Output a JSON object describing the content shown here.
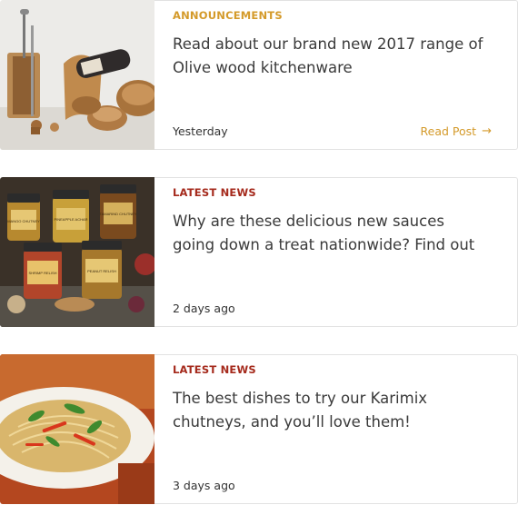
{
  "posts": [
    {
      "category": "ANNOUNCEMENTS",
      "title": "Read about our brand new 2017 range of Olive wood kitchenware",
      "date": "Yesterday",
      "link_label": "Read Post",
      "link_icon": "arrow-right-icon",
      "category_color": "#d49a2a",
      "image": "olive-wood-kitchenware-photo"
    },
    {
      "category": "LATEST NEWS",
      "title": "Why are these delicious new sauces going down a treat nationwide? Find out",
      "date": "2 days ago",
      "category_color": "#a52a1c",
      "image": "karimix-sauce-jars-photo",
      "jar_labels": [
        "MANGO CHUTNEY",
        "PINEAPPLE ACHAR",
        "TAMARIND CHUTNEY",
        "SHRIMP RELISH",
        "PEANUT RELISH"
      ]
    },
    {
      "category": "LATEST NEWS",
      "title": "The best dishes to try our Karimix chutneys, and you’ll love them!",
      "date": "3 days ago",
      "category_color": "#a52a1c",
      "image": "noodle-salad-dish-photo"
    }
  ]
}
